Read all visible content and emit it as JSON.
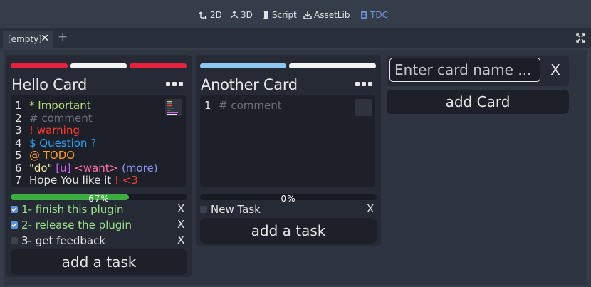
{
  "toolbar": {
    "items": [
      {
        "label": "2D",
        "icon": "2d-icon"
      },
      {
        "label": "3D",
        "icon": "3d-icon"
      },
      {
        "label": "Script",
        "icon": "script-icon"
      },
      {
        "label": "AssetLib",
        "icon": "assetlib-icon"
      },
      {
        "label": "TDC",
        "icon": "tdc-icon",
        "active": true
      }
    ]
  },
  "tabs": {
    "active_label": "[empty]",
    "close_glyph": "✕",
    "add_glyph": "+"
  },
  "colors": {
    "red": "#e8213f",
    "white": "#f4f4f4",
    "light_blue": "#8cc8f0",
    "green": "#3cae3f",
    "accent": "#6f95d6"
  },
  "cards": [
    {
      "title": "Hello Card",
      "color_bars": [
        "red",
        "white",
        "red"
      ],
      "code_lines": [
        {
          "n": "1",
          "segs": [
            {
              "t": "* Important",
              "c": "#b8e07a"
            }
          ]
        },
        {
          "n": "2",
          "segs": [
            {
              "t": "# comment",
              "c": "#6a6f7a"
            }
          ]
        },
        {
          "n": "3",
          "segs": [
            {
              "t": "! warning",
              "c": "#ff3b2e"
            }
          ]
        },
        {
          "n": "4",
          "segs": [
            {
              "t": "$ Question ?",
              "c": "#2ea0f0"
            }
          ]
        },
        {
          "n": "5",
          "segs": [
            {
              "t": "@ TODO",
              "c": "#ff9a1f"
            }
          ]
        },
        {
          "n": "6",
          "segs": [
            {
              "t": "\"do\" ",
              "c": "#f2e6a6"
            },
            {
              "t": "[u] ",
              "c": "#d25cf0"
            },
            {
              "t": "<want> ",
              "c": "#ff6fa8"
            },
            {
              "t": "(more)",
              "c": "#8f8ff0"
            }
          ]
        },
        {
          "n": "7",
          "segs": [
            {
              "t": "Hope You like it ",
              "c": "#e6e6e6"
            },
            {
              "t": "! <3",
              "c": "#ff3b2e"
            }
          ]
        }
      ],
      "progress": 0.67,
      "progress_text": "67%",
      "tasks": [
        {
          "label": "1- finish this plugin",
          "done": true
        },
        {
          "label": "2- release the plugin",
          "done": true
        },
        {
          "label": "3- get feedback",
          "done": false
        }
      ],
      "add_task_label": "add a task"
    },
    {
      "title": "Another Card",
      "color_bars": [
        "light_blue",
        "white"
      ],
      "code_lines": [
        {
          "n": "1",
          "segs": [
            {
              "t": "# comment",
              "c": "#6a6f7a"
            }
          ]
        }
      ],
      "progress": 0.0,
      "progress_text": "0%",
      "tasks": [
        {
          "label": "New Task",
          "done": false
        }
      ],
      "add_task_label": "add a task"
    }
  ],
  "task_delete_glyph": "X",
  "new_card": {
    "placeholder": "Enter card name ...",
    "value": "",
    "clear_label": "X",
    "add_label": "add Card"
  }
}
